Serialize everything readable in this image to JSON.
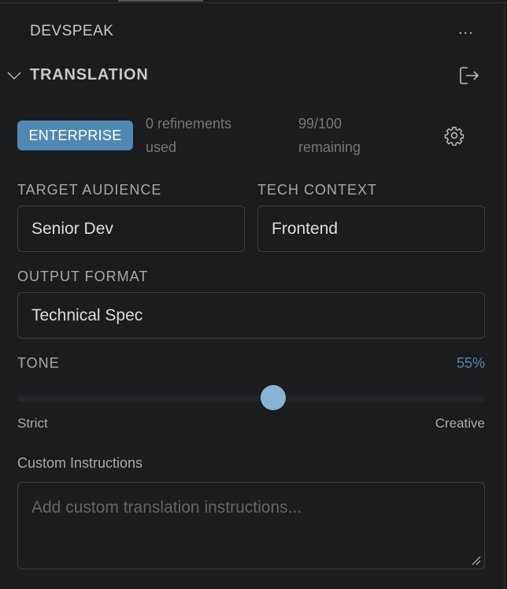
{
  "panel": {
    "title": "DEVSPEAK",
    "more_label": "..."
  },
  "section": {
    "title": "TRANSLATION"
  },
  "plan": {
    "badge": "ENTERPRISE",
    "refinements_line1": "0 refinements",
    "refinements_line2": "used",
    "remaining_line1": "99/100",
    "remaining_line2": "remaining"
  },
  "fields": {
    "target_audience": {
      "label": "TARGET AUDIENCE",
      "value": "Senior Dev"
    },
    "tech_context": {
      "label": "TECH CONTEXT",
      "value": "Frontend"
    },
    "output_format": {
      "label": "OUTPUT FORMAT",
      "value": "Technical Spec"
    }
  },
  "tone": {
    "label": "TONE",
    "value_label": "55%",
    "value": 55,
    "min_label": "Strict",
    "max_label": "Creative"
  },
  "custom": {
    "label": "Custom Instructions",
    "placeholder": "Add custom translation instructions..."
  },
  "colors": {
    "accent": "#4f88b0",
    "thumb": "#86b4d2",
    "percent": "#4f88b0"
  }
}
